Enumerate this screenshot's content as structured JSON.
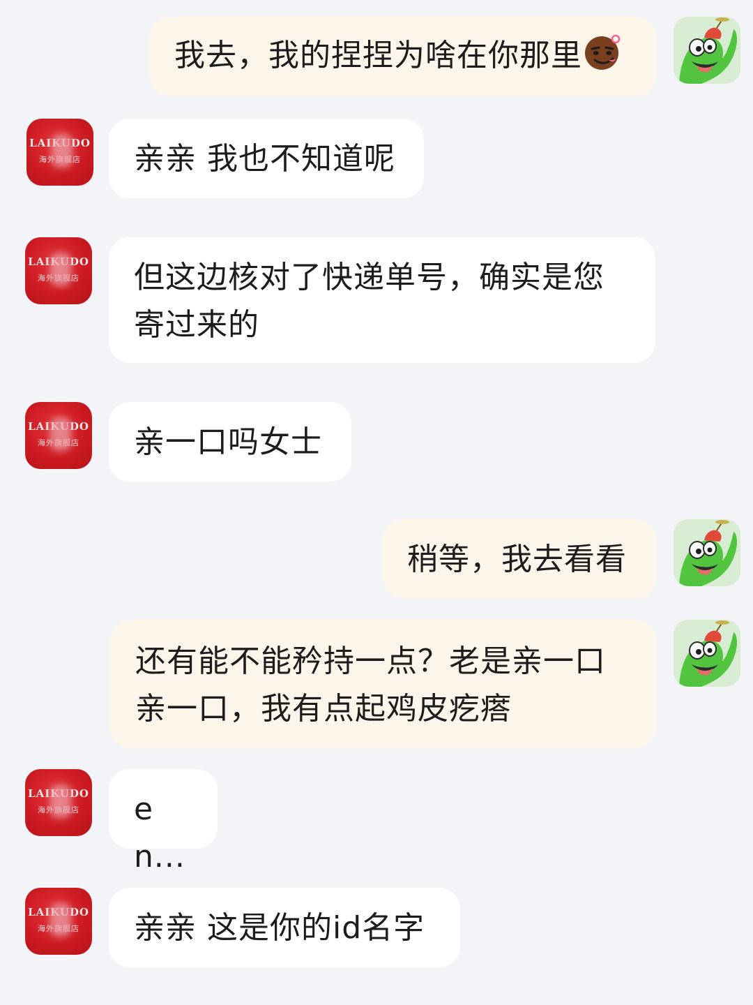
{
  "messages": [
    {
      "side": "out",
      "text": "我去，我的捏捏为啥在你那里",
      "emoji": "smirk-face-emoji"
    },
    {
      "side": "in",
      "text": "亲亲 我也不知道呢"
    },
    {
      "side": "in",
      "text": "但这边核对了快递单号，确实是您寄过来的"
    },
    {
      "side": "in",
      "text": "亲一口吗女士"
    },
    {
      "side": "out",
      "text": "稍等，我去看看"
    },
    {
      "side": "out",
      "text": "还有能不能矜持一点？老是亲一口亲一口，我有点起鸡皮疙瘩"
    },
    {
      "side": "in",
      "text": "en..."
    },
    {
      "side": "in",
      "text": "亲亲 这是你的id名字"
    }
  ],
  "shop_avatar": {
    "brand": "LAIKUDO",
    "sub": "海外旗舰店",
    "color": "#cc1b22"
  },
  "user_avatar": {
    "icon": "green-cartoon-avatar-icon",
    "color": "#d8ecd3"
  },
  "colors": {
    "background": "#f2f4f7",
    "incoming_bubble": "#ffffff",
    "outgoing_bubble": "#fcf6ea"
  }
}
